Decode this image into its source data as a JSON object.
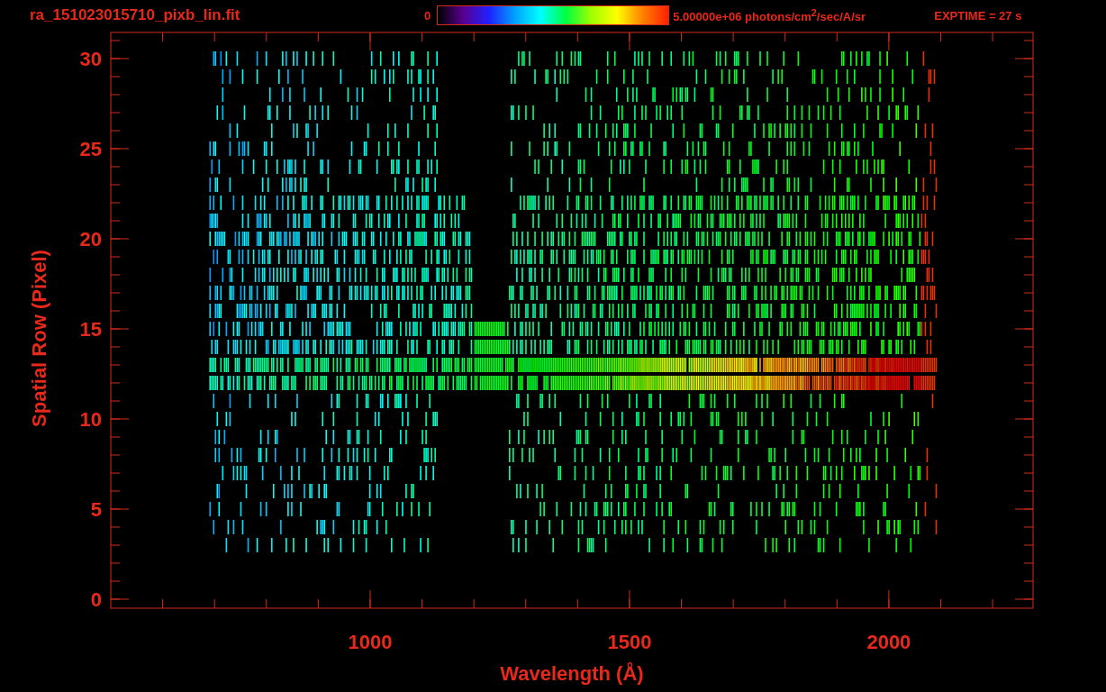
{
  "title": "ra_151023015710_pixb_lin.fit",
  "colorbar": {
    "min_label": "0",
    "max_label": "5.00000e+06 photons/cm$^{2}$/sec/A/sr"
  },
  "exposure": "EXPTIME = 27 s",
  "plot": {
    "xlabel": "Wavelength (Å)",
    "ylabel": "Spatial Row (Pixel)",
    "xticks": [
      "1000",
      "1500",
      "2000"
    ],
    "yticks": [
      "30",
      "25",
      "20",
      "15",
      "10",
      "5",
      "0"
    ]
  }
}
